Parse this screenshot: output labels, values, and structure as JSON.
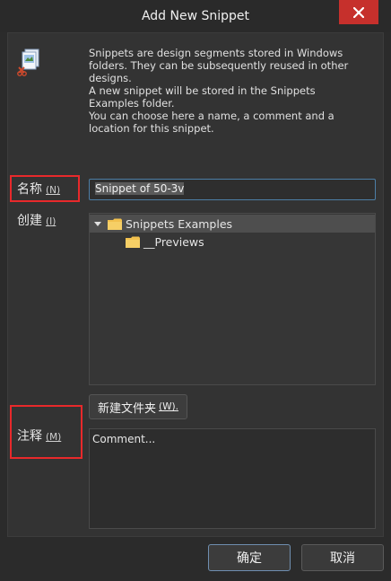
{
  "window": {
    "title": "Add New Snippet",
    "close_symbol": "×"
  },
  "description": "Snippets are design segments stored in Windows\nfolders. They can be subsequently reused in other\ndesigns.\nA new snippet will be stored in the Snippets\nExamples folder.\nYou can choose here a name, a comment and a\nlocation for this snippet.",
  "name_field": {
    "label": "名称",
    "accel": "(N)",
    "value": "Snippet of 50-3v"
  },
  "location": {
    "label": "创建",
    "accel": "(I)",
    "tree": [
      {
        "label": "Snippets Examples",
        "expanded": true,
        "selected": true
      },
      {
        "label": "__Previews",
        "expanded": false,
        "selected": false
      }
    ]
  },
  "new_folder_button": {
    "label": "新建文件夹",
    "accel": "(W)."
  },
  "comment_field": {
    "label": "注释",
    "accel": "(M)",
    "value": "Comment..."
  },
  "buttons": {
    "ok": "确定",
    "cancel": "取消"
  },
  "colors": {
    "background": "#2b2b2b",
    "panel": "#333333",
    "close_button": "#c6302c",
    "highlight_box": "#e8292b",
    "folder": "#f2c14e",
    "focus_border": "#4c7ea6"
  },
  "icons": [
    "snippet-icon",
    "close-icon",
    "expand-triangle-icon",
    "folder-icon"
  ]
}
